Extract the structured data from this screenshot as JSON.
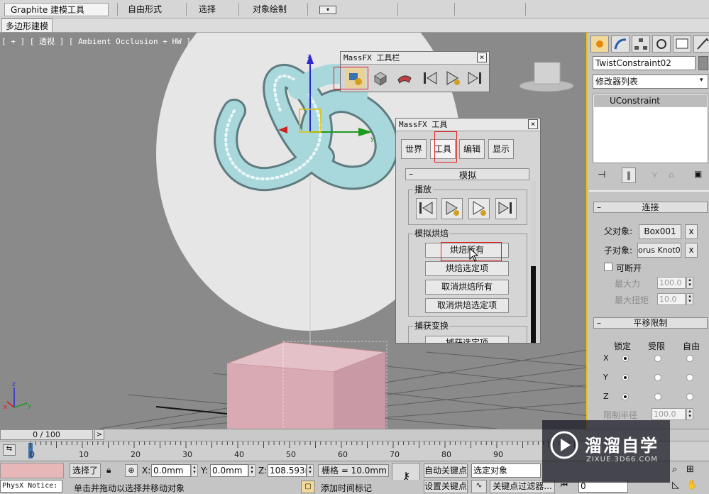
{
  "ribbon": {
    "tabs": [
      "Graphite 建模工具",
      "自由形式",
      "选择",
      "对象绘制"
    ],
    "active_tab": "Graphite 建模工具",
    "sub_tab": "多边形建模"
  },
  "viewport": {
    "label": "[ + ] [ 透视 ] [ Ambient Occlusion + HW ]",
    "axis_labels": {
      "x": "x",
      "y": "y",
      "z": "z"
    }
  },
  "massfx_toolbar": {
    "title": "MassFX 工具栏",
    "close": "×",
    "buttons": [
      "massfx-tools-icon",
      "rigid-body-icon",
      "cloth-icon",
      "reset-simulation-icon",
      "start-simulation-icon",
      "step-simulation-icon"
    ]
  },
  "massfx_tools": {
    "title": "MassFX 工具",
    "close": "×",
    "tabs": [
      "世界",
      "工具",
      "编辑",
      "显示"
    ],
    "active_tab": "工具",
    "rollout_title": "模拟",
    "playback_group": "播放",
    "bake_group": "模拟烘焙",
    "bake_buttons": [
      "烘焙所有",
      "烘焙选定项",
      "取消烘焙所有",
      "取消烘焙选定项"
    ],
    "capture_group": "捕获变换",
    "capture_partial": "捕获选定项"
  },
  "command_panel": {
    "object_name": "TwistConstraint02",
    "modifier_list": "修改器列表",
    "stack_item": "UConstraint",
    "connect_rollout": "连接",
    "parent_label": "父对象:",
    "parent_value": "Box001",
    "child_label": "子对象:",
    "child_value": "orus Knot00",
    "x_btn": "x",
    "breakable_label": "可断开",
    "max_force_label": "最大力",
    "max_force_value": "100.0",
    "max_torque_label": "最大扭矩",
    "max_torque_value": "10.0",
    "translation_rollout": "平移限制",
    "col_headers": [
      "锁定",
      "受限",
      "自由"
    ],
    "axes": [
      "X",
      "Y",
      "Z"
    ],
    "limit_radius_label": "限制半径",
    "limit_radius_value": "100.0"
  },
  "timeline": {
    "frame_counter": "0 / 100",
    "next": ">",
    "ticks": [
      "0",
      "10",
      "20",
      "30",
      "40",
      "50",
      "60",
      "70",
      "80",
      "90"
    ]
  },
  "status": {
    "selected": "选择了",
    "x_label": "X:",
    "x_value": "0.0mm",
    "y_label": "Y:",
    "y_value": "0.0mm",
    "z_label": "Z:",
    "z_value": "108.593mr",
    "grid": "栅格 = 10.0mm",
    "auto_key": "自动关键点",
    "selection_dropdown": "选定对象",
    "set_key": "设置关键点",
    "key_filter": "关键点过滤器...",
    "frame_field": "0",
    "prompt_left": "PhysX Notice:",
    "prompt_text": "单击并拖动以选择并移动对象",
    "add_time_tag": "添加时间标记"
  },
  "watermark": {
    "brand": "溜溜自学",
    "url": "ZIXUE.3D66.COM"
  },
  "colors": {
    "highlight_red": "#e02020",
    "viewport_border": "#f2c400",
    "torus_knot": "#a8d8dc",
    "box": "#d9a9b4"
  }
}
